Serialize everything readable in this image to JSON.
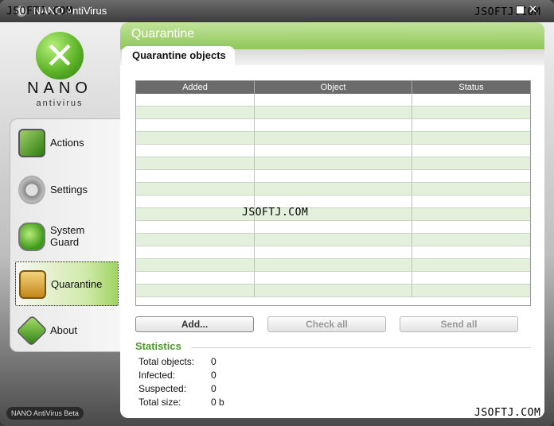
{
  "window": {
    "title": "NANO AntiVirus",
    "watermark": "JSOFTJ.COM",
    "version_badge": "NANO AntiVirus Beta"
  },
  "logo": {
    "name": "NANO",
    "sub": "antivirus"
  },
  "sidebar": {
    "items": [
      {
        "label": "Actions",
        "icon": "actions-icon"
      },
      {
        "label": "Settings",
        "icon": "gear-icon"
      },
      {
        "label": "System Guard",
        "icon": "shield-icon"
      },
      {
        "label": "Quarantine",
        "icon": "lock-icon",
        "active": true
      },
      {
        "label": "About",
        "icon": "info-icon"
      }
    ]
  },
  "main": {
    "title": "Quarantine",
    "tab": "Quarantine objects",
    "table": {
      "columns": [
        "Added",
        "Object",
        "Status"
      ],
      "rows": []
    },
    "buttons": {
      "add": "Add...",
      "check_all": "Check all",
      "send_all": "Send all"
    },
    "stats": {
      "title": "Statistics",
      "rows": [
        {
          "label": "Total objects:",
          "value": "0"
        },
        {
          "label": "Infected:",
          "value": "0"
        },
        {
          "label": "Suspected:",
          "value": "0"
        },
        {
          "label": "Total size:",
          "value": "0 b"
        }
      ]
    }
  },
  "colors": {
    "accent": "#8fc75a",
    "stats_title": "#4c9a2a",
    "row_alt": "#e2f0dc"
  }
}
